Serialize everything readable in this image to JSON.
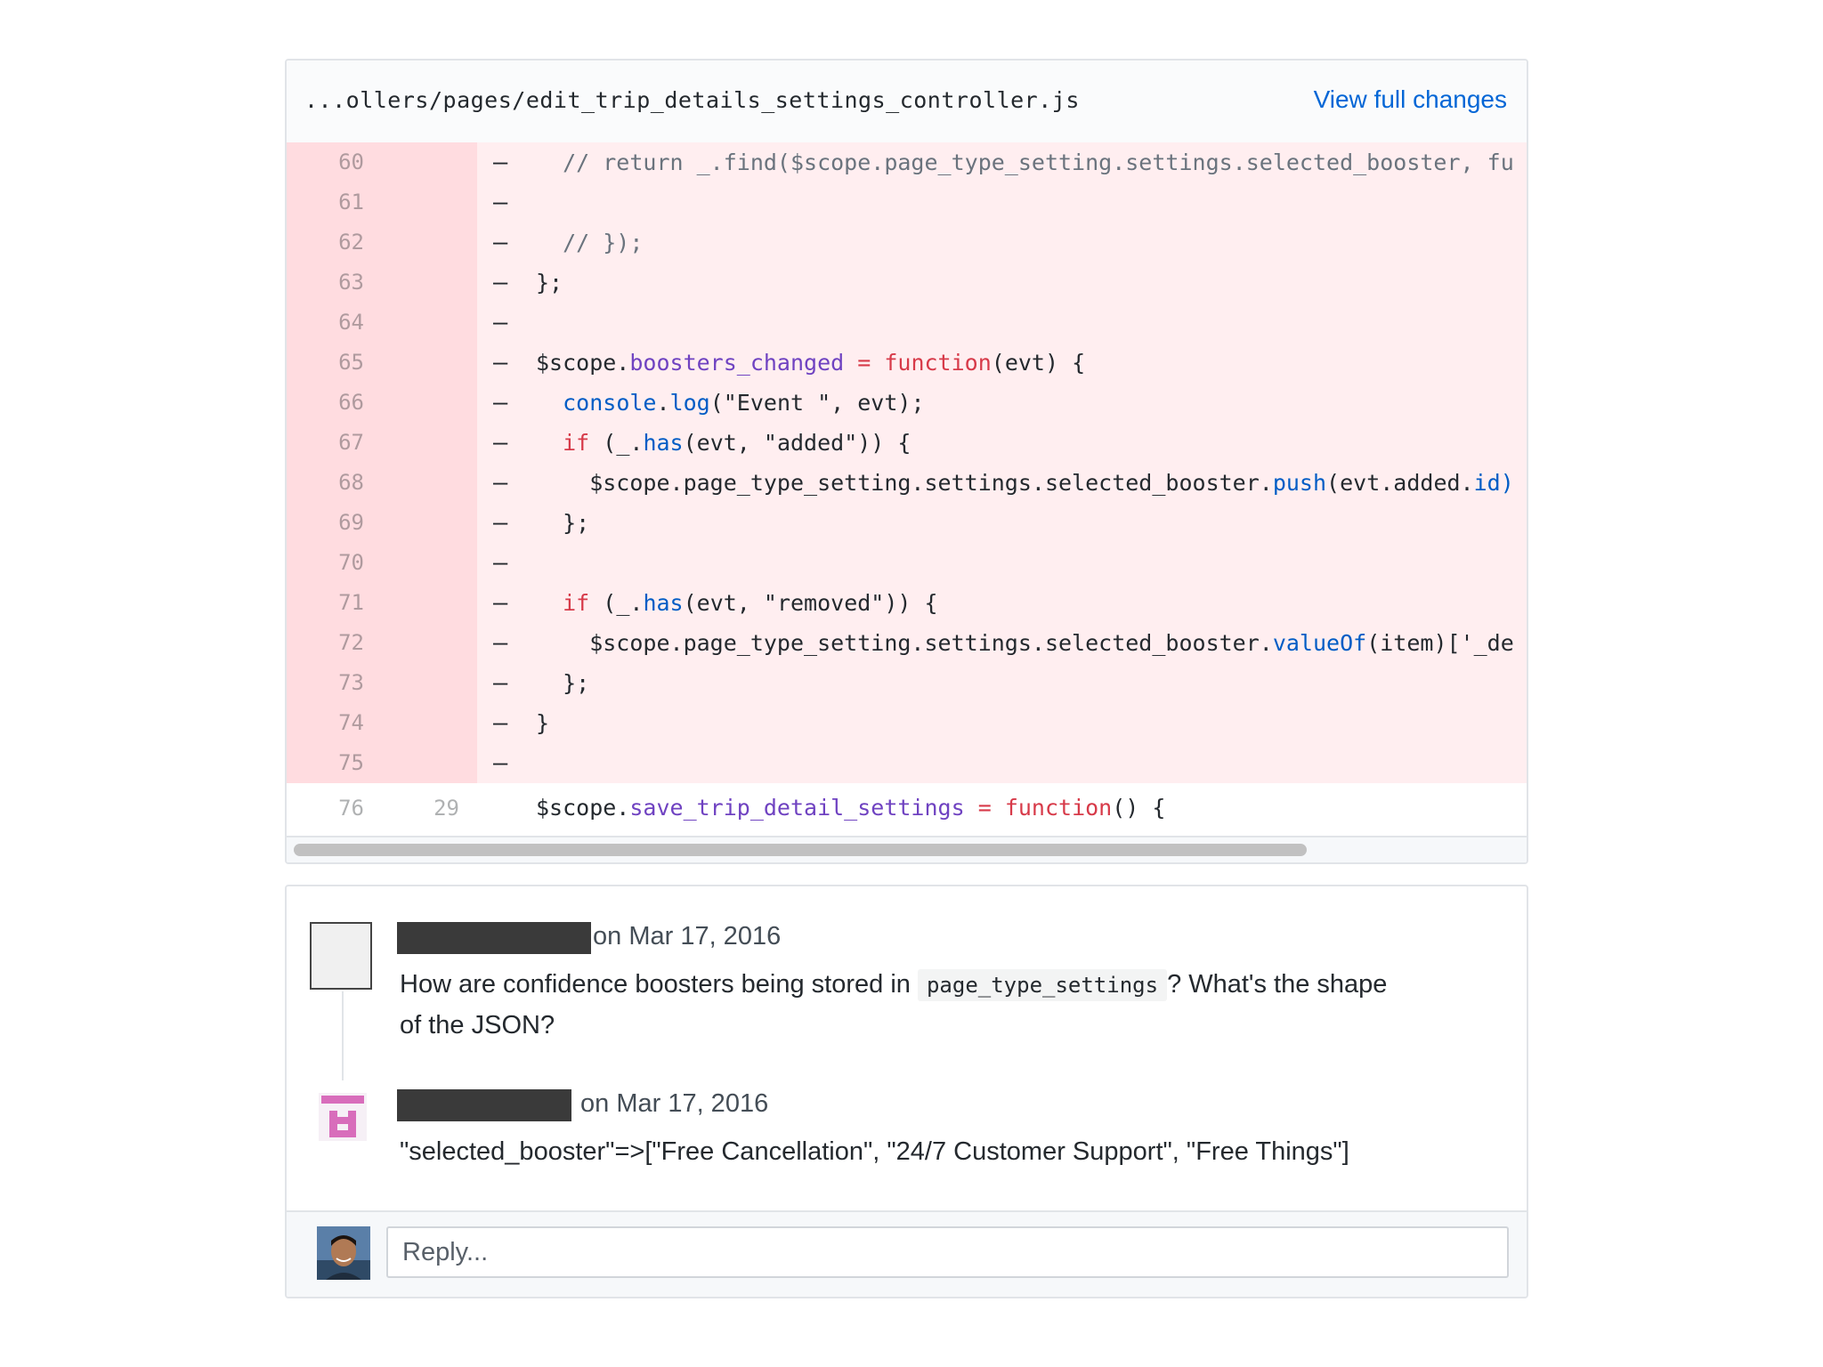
{
  "diff": {
    "file_path": "...ollers/pages/edit_trip_details_settings_controller.js",
    "view_full_label": "View full changes",
    "rows": [
      {
        "type": "del",
        "old": "60",
        "new": "",
        "sign": "–",
        "tokens": [
          {
            "t": "  // return _.find($scope.page_type_setting.settings.selected_booster, fu",
            "c": "comment"
          }
        ]
      },
      {
        "type": "del",
        "old": "61",
        "new": "",
        "sign": "–",
        "tokens": []
      },
      {
        "type": "del",
        "old": "62",
        "new": "",
        "sign": "–",
        "tokens": [
          {
            "t": "  // });",
            "c": "comment"
          }
        ]
      },
      {
        "type": "del",
        "old": "63",
        "new": "",
        "sign": "–",
        "tokens": [
          {
            "t": "};",
            "c": "plain"
          }
        ]
      },
      {
        "type": "del",
        "old": "64",
        "new": "",
        "sign": "–",
        "tokens": []
      },
      {
        "type": "del",
        "old": "65",
        "new": "",
        "sign": "–",
        "tokens": [
          {
            "t": "$scope.",
            "c": "plain"
          },
          {
            "t": "boosters_changed",
            "c": "prop"
          },
          {
            "t": " = ",
            "c": "keyword"
          },
          {
            "t": "function",
            "c": "keyword"
          },
          {
            "t": "(evt) {",
            "c": "plain"
          }
        ]
      },
      {
        "type": "del",
        "old": "66",
        "new": "",
        "sign": "–",
        "tokens": [
          {
            "t": "  ",
            "c": "plain"
          },
          {
            "t": "console",
            "c": "fn"
          },
          {
            "t": ".",
            "c": "plain"
          },
          {
            "t": "log",
            "c": "fn"
          },
          {
            "t": "(\"Event \", evt);",
            "c": "plain"
          }
        ]
      },
      {
        "type": "del",
        "old": "67",
        "new": "",
        "sign": "–",
        "tokens": [
          {
            "t": "  ",
            "c": "plain"
          },
          {
            "t": "if",
            "c": "keyword"
          },
          {
            "t": " (_.",
            "c": "plain"
          },
          {
            "t": "has",
            "c": "fn"
          },
          {
            "t": "(evt, \"added\")) {",
            "c": "plain"
          }
        ]
      },
      {
        "type": "del",
        "old": "68",
        "new": "",
        "sign": "–",
        "tokens": [
          {
            "t": "    $scope.page_type_setting.settings.selected_booster.",
            "c": "plain"
          },
          {
            "t": "push",
            "c": "fn"
          },
          {
            "t": "(evt.added.",
            "c": "plain"
          },
          {
            "t": "id)",
            "c": "fn"
          }
        ]
      },
      {
        "type": "del",
        "old": "69",
        "new": "",
        "sign": "–",
        "tokens": [
          {
            "t": "  };",
            "c": "plain"
          }
        ]
      },
      {
        "type": "del",
        "old": "70",
        "new": "",
        "sign": "–",
        "tokens": []
      },
      {
        "type": "del",
        "old": "71",
        "new": "",
        "sign": "–",
        "tokens": [
          {
            "t": "  ",
            "c": "plain"
          },
          {
            "t": "if",
            "c": "keyword"
          },
          {
            "t": " (_.",
            "c": "plain"
          },
          {
            "t": "has",
            "c": "fn"
          },
          {
            "t": "(evt, \"removed\")) {",
            "c": "plain"
          }
        ]
      },
      {
        "type": "del",
        "old": "72",
        "new": "",
        "sign": "–",
        "tokens": [
          {
            "t": "    $scope.page_type_setting.settings.selected_booster.",
            "c": "plain"
          },
          {
            "t": "valueOf",
            "c": "fn"
          },
          {
            "t": "(item)['_de",
            "c": "plain"
          }
        ]
      },
      {
        "type": "del",
        "old": "73",
        "new": "",
        "sign": "–",
        "tokens": [
          {
            "t": "  };",
            "c": "plain"
          }
        ]
      },
      {
        "type": "del",
        "old": "74",
        "new": "",
        "sign": "–",
        "tokens": [
          {
            "t": "}",
            "c": "plain"
          }
        ]
      },
      {
        "type": "del",
        "old": "75",
        "new": "",
        "sign": "–",
        "tokens": []
      },
      {
        "type": "ctx",
        "old": "76",
        "new": "29",
        "sign": "",
        "tokens": [
          {
            "t": "$scope.",
            "c": "plain"
          },
          {
            "t": "save_trip_detail_settings",
            "c": "prop"
          },
          {
            "t": " = ",
            "c": "keyword"
          },
          {
            "t": "function",
            "c": "keyword"
          },
          {
            "t": "() {",
            "c": "plain"
          }
        ]
      }
    ]
  },
  "comments": [
    {
      "meta": "on Mar 17, 2016",
      "text_before": "How are confidence boosters being stored in",
      "code": "page_type_settings",
      "text_after": "? What's the shape",
      "text_line2": "of the JSON?"
    },
    {
      "meta": "on Mar 17, 2016",
      "text": "\"selected_booster\"=>[\"Free Cancellation\", \"24/7 Customer Support\", \"Free Things\"]"
    }
  ],
  "reply": {
    "placeholder": "Reply..."
  },
  "colors": {
    "link": "#0366d6",
    "deleted_bg": "#ffeef0",
    "deleted_gutter": "#ffdce0",
    "keyword": "#d73a49",
    "property": "#6f42c1",
    "function": "#005cc5"
  }
}
